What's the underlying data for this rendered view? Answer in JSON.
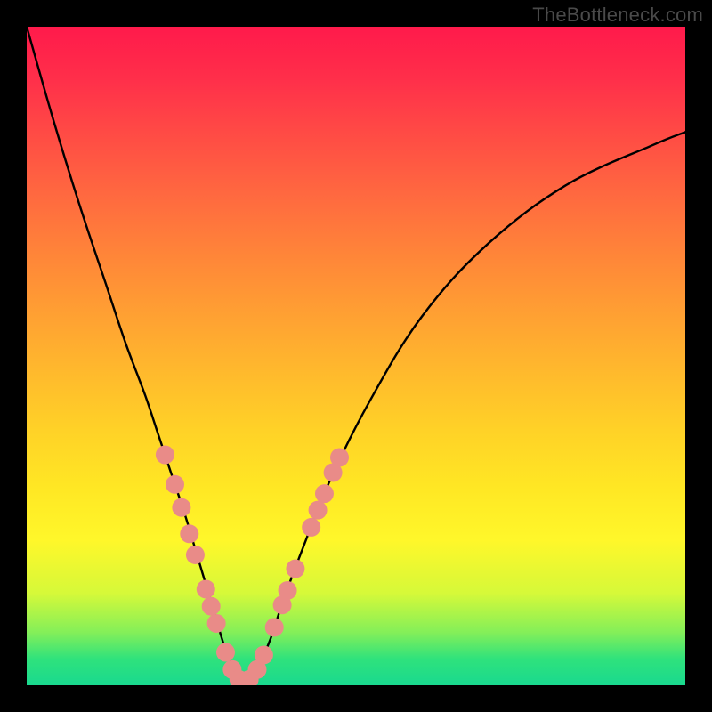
{
  "watermark": {
    "text": "TheBottleneck.com"
  },
  "chart_data": {
    "type": "line",
    "title": "",
    "xlabel": "",
    "ylabel": "",
    "xlim": [
      0,
      100
    ],
    "ylim": [
      0,
      100
    ],
    "series": [
      {
        "name": "bottleneck-curve",
        "x": [
          0,
          4,
          8,
          12,
          15,
          18,
          20,
          22,
          24,
          25.5,
          27,
          28.5,
          30,
          31.5,
          32.5,
          33.5,
          35,
          37,
          39,
          42,
          46,
          52,
          60,
          70,
          82,
          95,
          100
        ],
        "y": [
          100,
          86,
          73,
          61,
          52,
          44,
          38,
          32,
          26,
          21,
          16,
          11,
          6,
          2.5,
          0.6,
          0.6,
          2.5,
          7,
          13,
          21,
          31,
          43,
          56,
          67,
          76,
          82,
          84
        ]
      }
    ],
    "markers": [
      {
        "x": 21.0,
        "y": 35.0
      },
      {
        "x": 22.5,
        "y": 30.5
      },
      {
        "x": 23.5,
        "y": 27.0
      },
      {
        "x": 24.7,
        "y": 23.0
      },
      {
        "x": 25.6,
        "y": 19.8
      },
      {
        "x": 27.2,
        "y": 14.6
      },
      {
        "x": 28.0,
        "y": 12.0
      },
      {
        "x": 28.8,
        "y": 9.4
      },
      {
        "x": 30.2,
        "y": 5.0
      },
      {
        "x": 31.2,
        "y": 2.4
      },
      {
        "x": 32.2,
        "y": 0.9
      },
      {
        "x": 33.8,
        "y": 0.9
      },
      {
        "x": 35.0,
        "y": 2.4
      },
      {
        "x": 36.0,
        "y": 4.6
      },
      {
        "x": 37.6,
        "y": 8.8
      },
      {
        "x": 38.8,
        "y": 12.2
      },
      {
        "x": 39.6,
        "y": 14.4
      },
      {
        "x": 40.8,
        "y": 17.7
      },
      {
        "x": 43.2,
        "y": 24.0
      },
      {
        "x": 44.2,
        "y": 26.6
      },
      {
        "x": 45.2,
        "y": 29.1
      },
      {
        "x": 46.5,
        "y": 32.3
      },
      {
        "x": 47.5,
        "y": 34.6
      }
    ],
    "colors": {
      "curve": "#000000",
      "marker_fill": "#e98b88",
      "marker_stroke": "#c96a67"
    }
  }
}
